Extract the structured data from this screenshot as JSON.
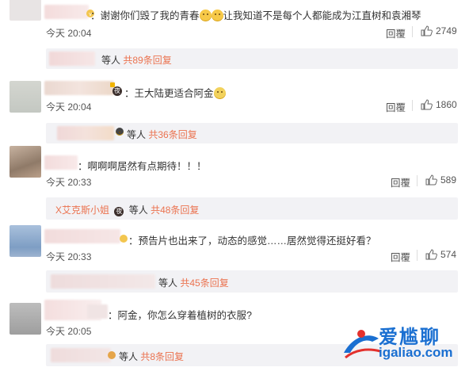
{
  "comments": [
    {
      "text": "：谢谢你们毁了我的青春",
      "text2": "让我知道不是每个人都能成为江直树和袁湘琴",
      "time": "今天 20:04",
      "reply": "回覆",
      "likes": "2749",
      "sub_prefix": "",
      "sub_mid": "等人",
      "sub_count": "共89条回复",
      "avatar_color": "#e9e6e6"
    },
    {
      "text": "：王大陆更适合阿金",
      "time": "今天 20:04",
      "reply": "回覆",
      "likes": "1860",
      "sub_prefix": "",
      "sub_mid": "等人",
      "sub_count": "共36条回复",
      "avatar_color": "#c9ccc6"
    },
    {
      "text": "：啊啊啊居然有点期待！！！",
      "time": "今天 20:33",
      "reply": "回覆",
      "likes": "589",
      "sub_prefix": "X艾克斯小姐",
      "sub_mid": "等人",
      "sub_count": "共48条回复",
      "avatar_color": "#a5907e"
    },
    {
      "text": "：预告片也出来了，动态的感觉……居然觉得还挺好看？",
      "time": "今天 20:33",
      "reply": "回覆",
      "likes": "574",
      "sub_prefix": "",
      "sub_mid": "等人",
      "sub_count": "共45条回复",
      "avatar_color": "#8fa9c7"
    },
    {
      "text": "：阿金，你怎么穿着植树的衣服?",
      "time": "今天 20:05",
      "reply": "",
      "likes": "",
      "sub_prefix": "",
      "sub_mid": "等人",
      "sub_count": "共8条回复",
      "avatar_color": "#b8b8b8"
    }
  ],
  "watermark": {
    "brand": "爱尴聊",
    "url": "igaliao.com",
    "colors": {
      "blue": "#1a6fd1",
      "red": "#e3312d"
    }
  },
  "icons": {
    "like": "thumbs-up-icon",
    "vip": "vip-badge-icon"
  }
}
